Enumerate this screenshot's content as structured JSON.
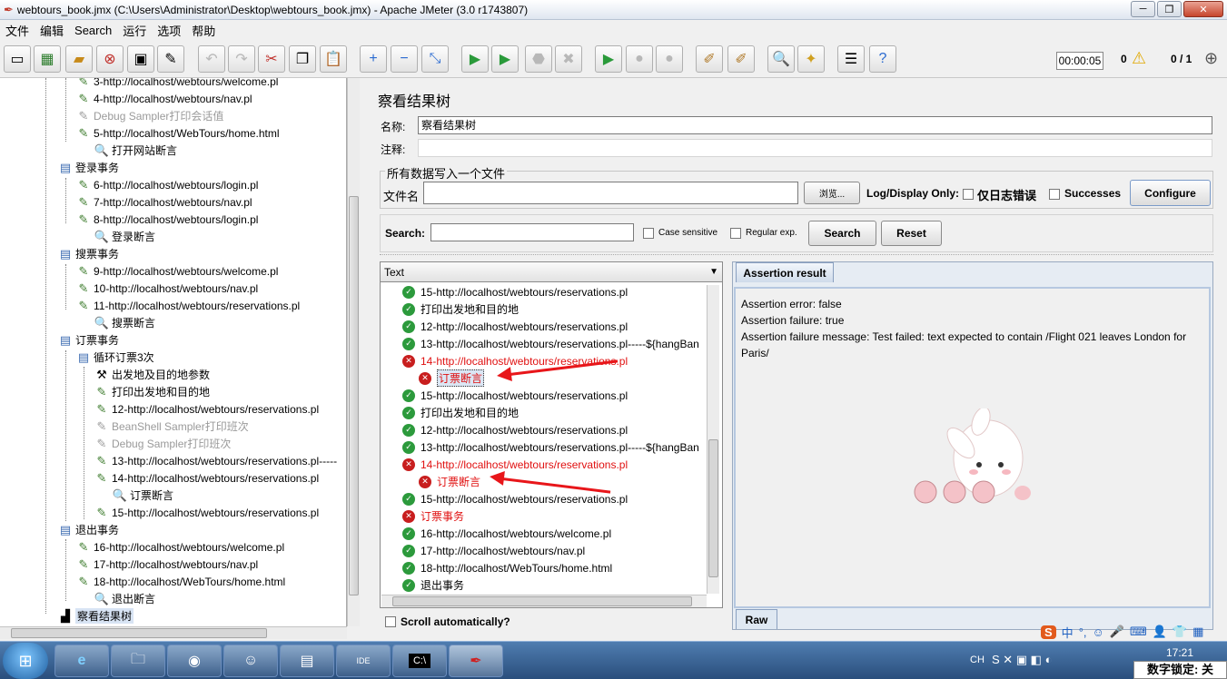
{
  "window": {
    "title": "webtours_book.jmx (C:\\Users\\Administrator\\Desktop\\webtours_book.jmx) - Apache JMeter (3.0 r1743807)"
  },
  "menu": [
    "文件",
    "编辑",
    "Search",
    "运行",
    "选项",
    "帮助"
  ],
  "toolbar": {
    "timer": "00:00:05",
    "warnings": "0",
    "threads": "0 / 1"
  },
  "left_tree": [
    {
      "label": "3-http://localhost/webtours/welcome.pl",
      "icon": "pencil-icon"
    },
    {
      "label": "4-http://localhost/webtours/nav.pl",
      "icon": "pencil-icon"
    },
    {
      "label": "Debug Sampler打印会话值",
      "icon": "pencil-icon",
      "disabled": true
    },
    {
      "label": "5-http://localhost/WebTours/home.html",
      "icon": "pencil-icon"
    },
    {
      "label": "打开网站断言",
      "icon": "magnifier-icon"
    },
    {
      "label": "登录事务",
      "icon": "transaction-icon"
    },
    {
      "label": "6-http://localhost/webtours/login.pl",
      "icon": "pencil-icon"
    },
    {
      "label": "7-http://localhost/webtours/nav.pl",
      "icon": "pencil-icon"
    },
    {
      "label": "8-http://localhost/webtours/login.pl",
      "icon": "pencil-icon"
    },
    {
      "label": "登录断言",
      "icon": "magnifier-icon"
    },
    {
      "label": "搜票事务",
      "icon": "transaction-icon"
    },
    {
      "label": "9-http://localhost/webtours/welcome.pl",
      "icon": "pencil-icon"
    },
    {
      "label": "10-http://localhost/webtours/nav.pl",
      "icon": "pencil-icon"
    },
    {
      "label": "11-http://localhost/webtours/reservations.pl",
      "icon": "pencil-icon"
    },
    {
      "label": "搜票断言",
      "icon": "magnifier-icon"
    },
    {
      "label": "订票事务",
      "icon": "transaction-icon"
    },
    {
      "label": "循环订票3次",
      "icon": "loop-icon"
    },
    {
      "label": "出发地及目的地参数",
      "icon": "tools-icon"
    },
    {
      "label": "打印出发地和目的地",
      "icon": "pencil-icon"
    },
    {
      "label": "12-http://localhost/webtours/reservations.pl",
      "icon": "pencil-icon"
    },
    {
      "label": "BeanShell Sampler打印班次",
      "icon": "pencil-icon",
      "disabled": true
    },
    {
      "label": "Debug Sampler打印班次",
      "icon": "pencil-icon",
      "disabled": true
    },
    {
      "label": "13-http://localhost/webtours/reservations.pl-----",
      "icon": "pencil-icon"
    },
    {
      "label": "14-http://localhost/webtours/reservations.pl",
      "icon": "pencil-icon"
    },
    {
      "label": "订票断言",
      "icon": "magnifier-icon"
    },
    {
      "label": "15-http://localhost/webtours/reservations.pl",
      "icon": "pencil-icon"
    },
    {
      "label": "退出事务",
      "icon": "transaction-icon"
    },
    {
      "label": "16-http://localhost/webtours/welcome.pl",
      "icon": "pencil-icon"
    },
    {
      "label": "17-http://localhost/webtours/nav.pl",
      "icon": "pencil-icon"
    },
    {
      "label": "18-http://localhost/WebTours/home.html",
      "icon": "pencil-icon"
    },
    {
      "label": "退出断言",
      "icon": "magnifier-icon"
    },
    {
      "label": "察看结果树",
      "icon": "chart-icon",
      "selected": true
    }
  ],
  "panel": {
    "title": "察看结果树",
    "name_label": "名称:",
    "name_value": "察看结果树",
    "comment_label": "注释:",
    "file_group_title": "所有数据写入一个文件",
    "filename_label": "文件名",
    "browse_label": "浏览...",
    "log_display_label": "Log/Display Only:",
    "errors_only_label": "仅日志错误",
    "successes_label": "Successes",
    "configure_label": "Configure",
    "search_label": "Search:",
    "case_sensitive_label": "Case sensitive",
    "regex_label": "Regular exp.",
    "search_button": "Search",
    "reset_button": "Reset",
    "render_select": "Text",
    "scroll_auto_label": "Scroll automatically?",
    "tab_assertion": "Assertion result",
    "tab_raw": "Raw"
  },
  "results": [
    {
      "label": "15-http://localhost/webtours/reservations.pl",
      "status": "ok"
    },
    {
      "label": "打印出发地和目的地",
      "status": "ok"
    },
    {
      "label": "12-http://localhost/webtours/reservations.pl",
      "status": "ok"
    },
    {
      "label": "13-http://localhost/webtours/reservations.pl-----${hangBan",
      "status": "ok"
    },
    {
      "label": "14-http://localhost/webtours/reservations.pl",
      "status": "fail"
    },
    {
      "label": "订票断言",
      "status": "fail",
      "child": true,
      "selected": true
    },
    {
      "label": "15-http://localhost/webtours/reservations.pl",
      "status": "ok"
    },
    {
      "label": "打印出发地和目的地",
      "status": "ok"
    },
    {
      "label": "12-http://localhost/webtours/reservations.pl",
      "status": "ok"
    },
    {
      "label": "13-http://localhost/webtours/reservations.pl-----${hangBan",
      "status": "ok"
    },
    {
      "label": "14-http://localhost/webtours/reservations.pl",
      "status": "fail"
    },
    {
      "label": "订票断言",
      "status": "fail",
      "child": true
    },
    {
      "label": "15-http://localhost/webtours/reservations.pl",
      "status": "ok"
    },
    {
      "label": "订票事务",
      "status": "fail"
    },
    {
      "label": "16-http://localhost/webtours/welcome.pl",
      "status": "ok"
    },
    {
      "label": "17-http://localhost/webtours/nav.pl",
      "status": "ok"
    },
    {
      "label": "18-http://localhost/WebTours/home.html",
      "status": "ok"
    },
    {
      "label": "退出事务",
      "status": "ok"
    }
  ],
  "assertion": [
    "Assertion error: false",
    "Assertion failure: true",
    "Assertion failure message: Test failed: text expected to contain /Flight 021 leaves London  for Paris/"
  ],
  "taskbar": {
    "clock": "17:21",
    "lang": "CH",
    "numlock": "数字锁定: 关"
  },
  "colors": {
    "fail": "#e01010",
    "ok": "#2c9a3c",
    "accent": "#2a4e7c"
  }
}
